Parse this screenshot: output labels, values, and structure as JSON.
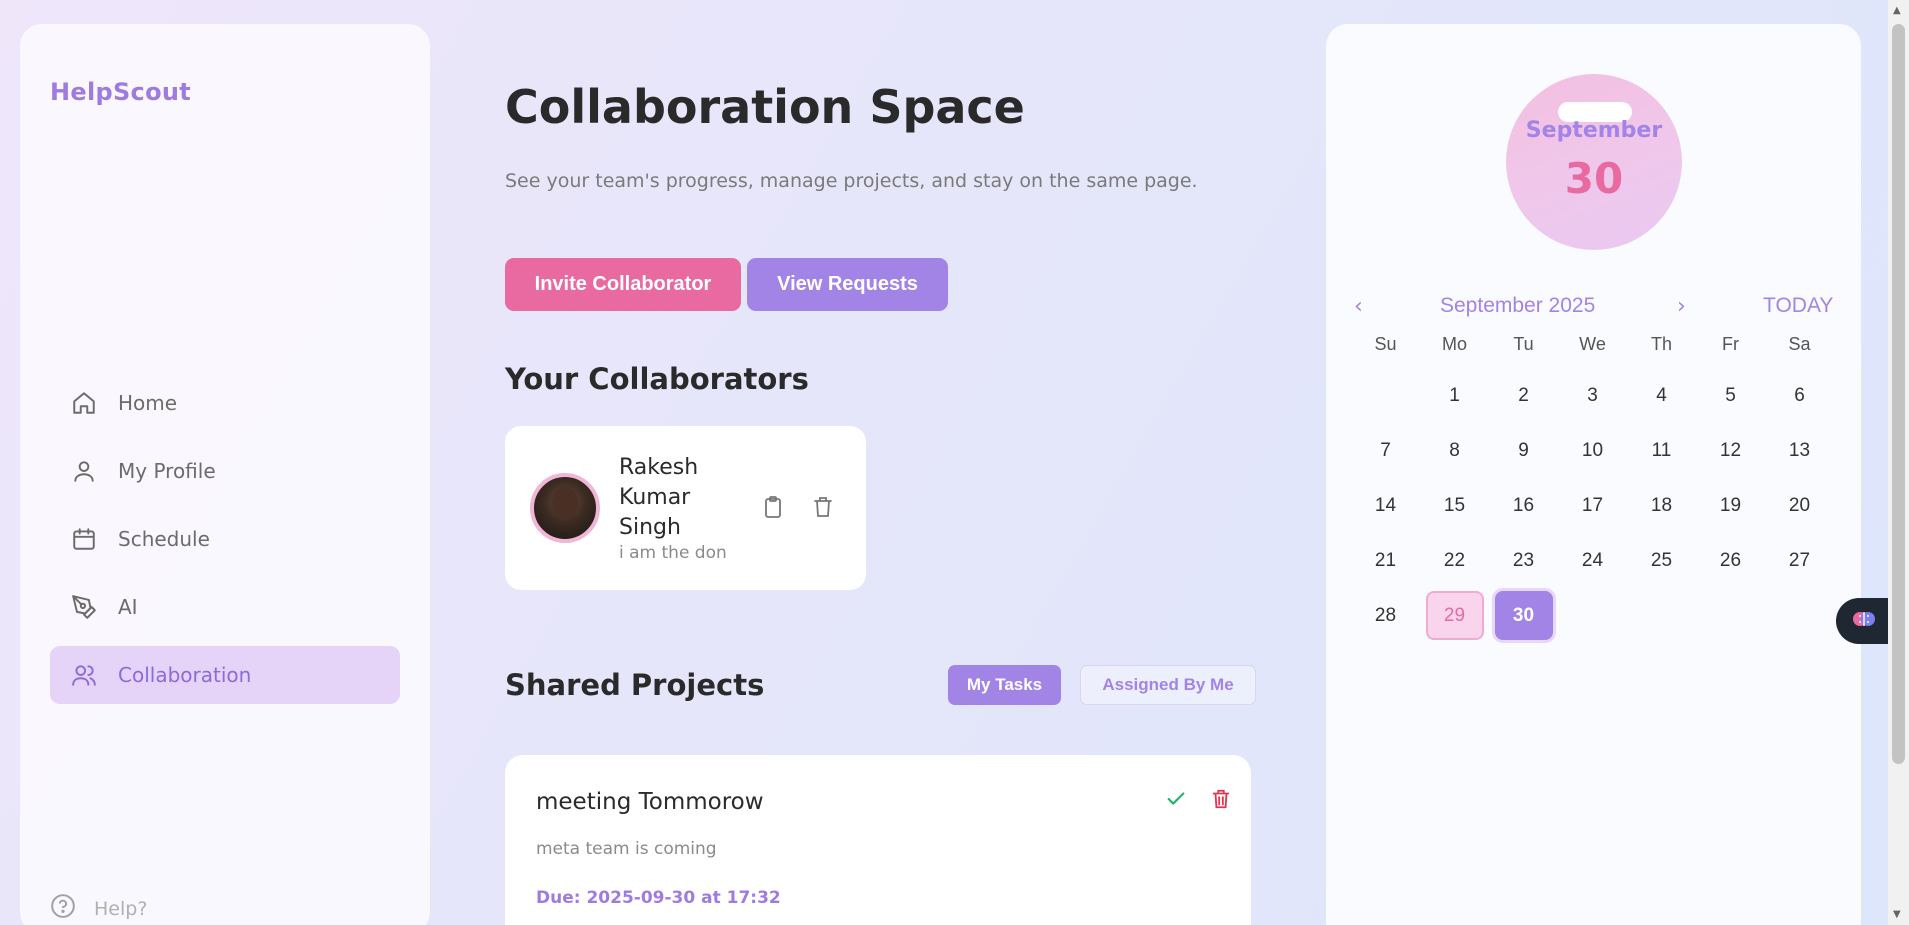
{
  "sidebar": {
    "brand": "HelpScout",
    "items": [
      {
        "label": "Home",
        "icon": "home-icon"
      },
      {
        "label": "My Profile",
        "icon": "user-icon"
      },
      {
        "label": "Schedule",
        "icon": "calendar-icon"
      },
      {
        "label": "AI",
        "icon": "pen-tool-icon"
      },
      {
        "label": "Collaboration",
        "icon": "users-icon",
        "active": true
      }
    ],
    "help": "Help?"
  },
  "main": {
    "title": "Collaboration Space",
    "subtitle": "See your team's progress, manage projects, and stay on the same page.",
    "invite_label": "Invite Collaborator",
    "requests_label": "View Requests",
    "collaborators_heading": "Your Collaborators",
    "collaborator": {
      "name": "Rakesh Kumar Singh",
      "bio": "i am the don"
    },
    "projects_heading": "Shared Projects",
    "tabs": {
      "my_tasks": "My Tasks",
      "assigned_by_me": "Assigned By Me"
    },
    "project": {
      "title": "meeting Tommorow",
      "description": "meta team is coming",
      "due": "Due: 2025-09-30 at 17:32"
    }
  },
  "calendar": {
    "bubble_month": "September",
    "bubble_day": "30",
    "prev": "‹",
    "next": "›",
    "month_label": "September 2025",
    "today_label": "TODAY",
    "weekdays": [
      "Su",
      "Mo",
      "Tu",
      "We",
      "Th",
      "Fr",
      "Sa"
    ],
    "leading_blanks": 1,
    "days": [
      "1",
      "2",
      "3",
      "4",
      "5",
      "6",
      "7",
      "8",
      "9",
      "10",
      "11",
      "12",
      "13",
      "14",
      "15",
      "16",
      "17",
      "18",
      "19",
      "20",
      "21",
      "22",
      "23",
      "24",
      "25",
      "26",
      "27",
      "28",
      "29",
      "30"
    ],
    "selected_day": "29",
    "today_day": "30"
  },
  "colors": {
    "accent_purple": "#a284e6",
    "accent_pink": "#e96aa1",
    "brand": "#9d7be0"
  }
}
